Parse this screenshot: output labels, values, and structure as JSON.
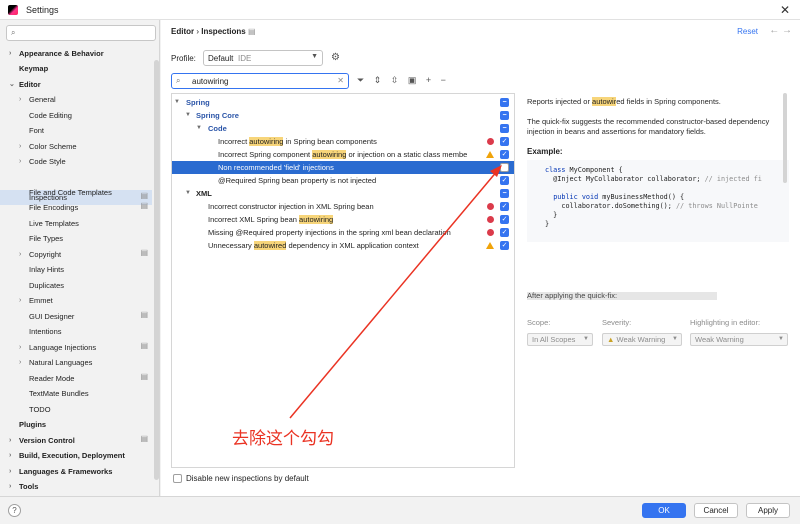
{
  "window": {
    "title": "Settings"
  },
  "sidebar": {
    "search_placeholder": "",
    "items": [
      {
        "label": "Appearance & Behavior"
      },
      {
        "label": "Keymap"
      },
      {
        "label": "Editor"
      },
      {
        "label": "General"
      },
      {
        "label": "Code Editing"
      },
      {
        "label": "Font"
      },
      {
        "label": "Color Scheme"
      },
      {
        "label": "Code Style"
      },
      {
        "label": "Inspections"
      },
      {
        "label": "File and Code Templates"
      },
      {
        "label": "File Encodings"
      },
      {
        "label": "Live Templates"
      },
      {
        "label": "File Types"
      },
      {
        "label": "Copyright"
      },
      {
        "label": "Inlay Hints"
      },
      {
        "label": "Duplicates"
      },
      {
        "label": "Emmet"
      },
      {
        "label": "GUI Designer"
      },
      {
        "label": "Intentions"
      },
      {
        "label": "Language Injections"
      },
      {
        "label": "Natural Languages"
      },
      {
        "label": "Reader Mode"
      },
      {
        "label": "TextMate Bundles"
      },
      {
        "label": "TODO"
      },
      {
        "label": "Plugins"
      },
      {
        "label": "Version Control"
      },
      {
        "label": "Build, Execution, Deployment"
      },
      {
        "label": "Languages & Frameworks"
      },
      {
        "label": "Tools"
      }
    ]
  },
  "header": {
    "breadcrumb_parent": "Editor",
    "breadcrumb_sep": "›",
    "breadcrumb_current": "Inspections",
    "reset": "Reset"
  },
  "profile": {
    "label": "Profile:",
    "value": "Default",
    "scope": "IDE"
  },
  "filter": {
    "value": "autowiring"
  },
  "inspections": {
    "spring": "Spring",
    "spring_core": "Spring Core",
    "code": "Code",
    "xml": "XML",
    "rows": [
      {
        "pre": "Incorrect ",
        "hl": "autowiring",
        "post": " in Spring bean components"
      },
      {
        "pre": "Incorrect Spring component ",
        "hl": "autowiring",
        "post": " or injection on a static class membe"
      },
      {
        "pre": "Non recommended 'field' injections",
        "hl": "",
        "post": ""
      },
      {
        "pre": "@Required Spring bean property is not injected",
        "hl": "",
        "post": ""
      },
      {
        "pre": "Incorrect constructor injection in XML Spring bean",
        "hl": "",
        "post": ""
      },
      {
        "pre": "Incorrect XML Spring bean ",
        "hl": "autowiring",
        "post": ""
      },
      {
        "pre": "Missing @Required property injections in the spring xml bean declaration",
        "hl": "",
        "post": ""
      },
      {
        "pre": "Unnecessary ",
        "hl": "autowired",
        "post": " dependency in XML application context"
      }
    ],
    "disable_new": "Disable new inspections by default"
  },
  "description": {
    "line1_pre": "Reports injected or ",
    "line1_hl": "autowir",
    "line1_post": "ed fields in Spring components.",
    "para2": "The quick-fix suggests the recommended constructor-based dependency injection in beans and assertions for mandatory fields.",
    "example": "Example:",
    "after_fix": "After applying the quick-fix:"
  },
  "options": {
    "scope_label": "Scope:",
    "scope_value": "In All Scopes",
    "severity_label": "Severity:",
    "severity_value": "Weak Warning",
    "highlight_label": "Highlighting in editor:",
    "highlight_value": "Weak Warning"
  },
  "annotation": {
    "text": "去除这个勾勾"
  },
  "footer": {
    "ok": "OK",
    "cancel": "Cancel",
    "apply": "Apply"
  },
  "colors": {
    "accent": "#3574f0",
    "selection": "#2a6bd0",
    "annotation": "#ea3323",
    "highlight": "#f7d57a"
  }
}
